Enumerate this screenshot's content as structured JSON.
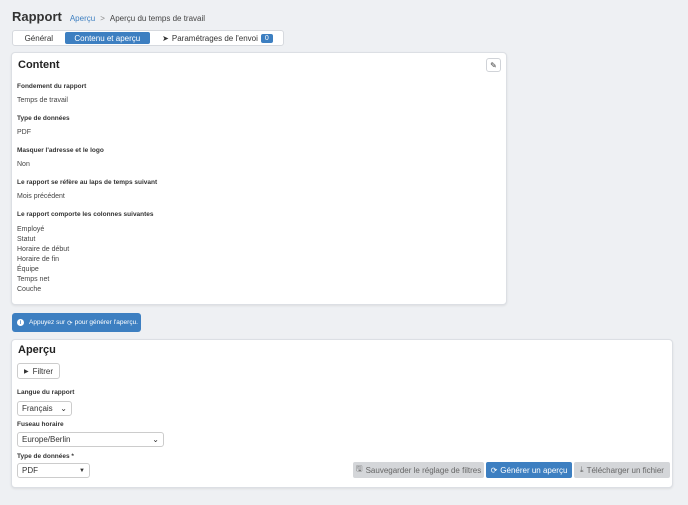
{
  "header": {
    "title": "Rapport",
    "breadcrumb_link": "Aperçu",
    "breadcrumb_sep": ">",
    "breadcrumb_current": "Aperçu du temps de travail"
  },
  "tabs": [
    {
      "label": "Général"
    },
    {
      "label": "Contenu et aperçu"
    },
    {
      "label": "Paramétrages de l'envoi",
      "badge": "0"
    }
  ],
  "content": {
    "title": "Content",
    "fields": [
      {
        "label": "Fondement du rapport",
        "value": "Temps de travail"
      },
      {
        "label": "Type de données",
        "value": "PDF"
      },
      {
        "label": "Masquer l'adresse et le logo",
        "value": "Non"
      },
      {
        "label": "Le rapport se réfère au laps de temps suivant",
        "value": "Mois précédent"
      },
      {
        "label": "Le rapport comporte les colonnes suivantes",
        "value": ""
      }
    ],
    "columns": [
      "Employé",
      "Statut",
      "Horaire de début",
      "Horaire de fin",
      "Équipe",
      "Temps net",
      "Couche"
    ]
  },
  "info_button": {
    "text_before": "Appuyez sur",
    "text_after": "pour générer l'aperçu."
  },
  "preview": {
    "title": "Aperçu",
    "filter_label": "Filtrer",
    "language_label": "Langue du rapport",
    "language_value": "Français",
    "timezone_label": "Fuseau horaire",
    "timezone_value": "Europe/Berlin",
    "datatype_label": "Type de données *",
    "datatype_value": "PDF",
    "save_label": "Sauvegarder le réglage de filtres",
    "generate_label": "Générer un aperçu",
    "download_label": "Télécharger un fichier"
  },
  "colors": {
    "accent": "#3d7fc1",
    "background": "#eef0f3",
    "disabled": "#d4d6d9"
  }
}
